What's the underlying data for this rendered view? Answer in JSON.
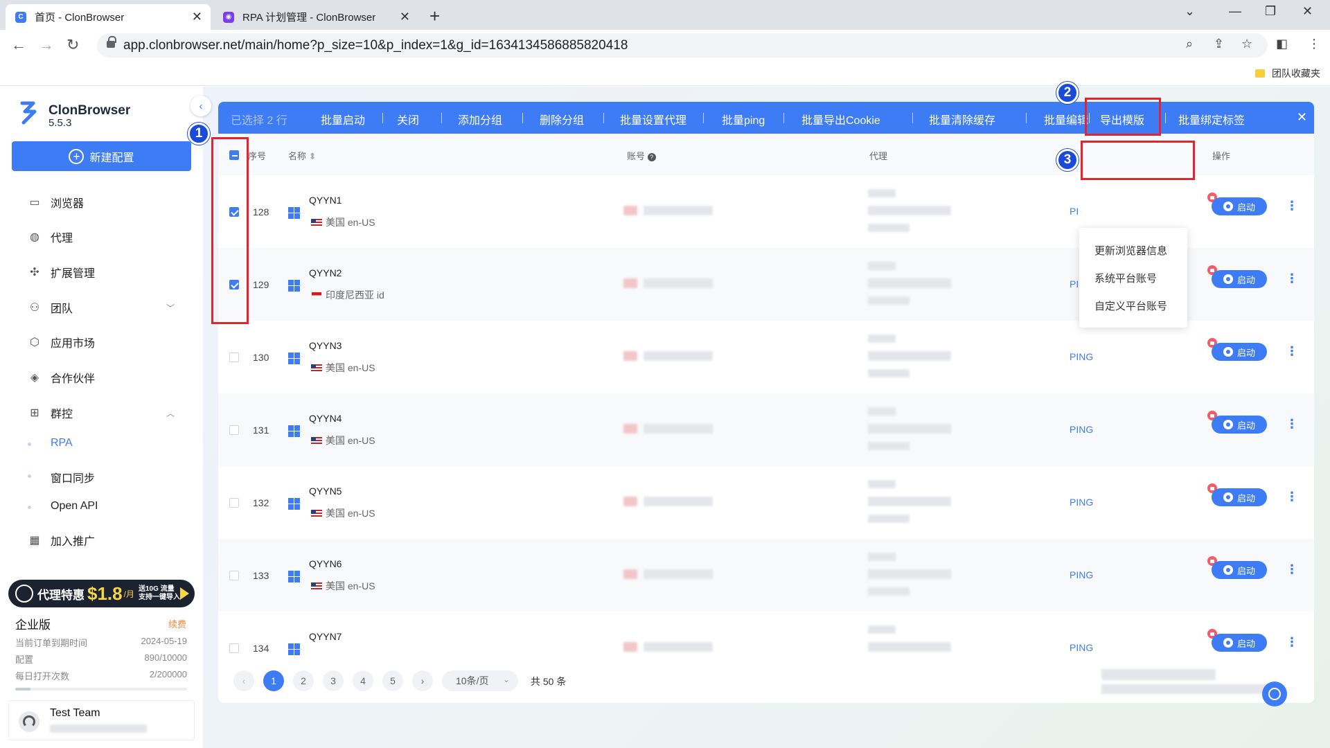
{
  "browser": {
    "tabs": [
      {
        "title": "首页 - ClonBrowser",
        "active": true
      },
      {
        "title": "RPA 计划管理 - ClonBrowser",
        "active": false
      }
    ],
    "url": "app.clonbrowser.net/main/home?p_size=10&p_index=1&g_id=1634134586885820418",
    "bookmark": "团队收藏夹"
  },
  "sidebar": {
    "brand": "ClonBrowser",
    "version": "5.5.3",
    "new_button": "新建配置",
    "menu": [
      {
        "label": "浏览器",
        "icon": "browser-icon"
      },
      {
        "label": "代理",
        "icon": "globe-icon"
      },
      {
        "label": "扩展管理",
        "icon": "puzzle-icon"
      },
      {
        "label": "团队",
        "icon": "team-icon"
      },
      {
        "label": "应用市场",
        "icon": "cube-icon"
      },
      {
        "label": "合作伙伴",
        "icon": "handshake-icon"
      },
      {
        "label": "群控",
        "icon": "group-control-icon"
      },
      {
        "label": "加入推广",
        "icon": "promo-icon"
      }
    ],
    "submenu": [
      "RPA",
      "窗口同步",
      "Open API"
    ],
    "promo": {
      "prefix": "代理特惠",
      "price": "$1.8",
      "unit": "/月",
      "line1": "送10G 流量",
      "line2": "支持一键导入"
    },
    "plan": {
      "title": "企业版",
      "renew": "续费",
      "rows": [
        {
          "label": "当前订单到期时间",
          "value": "2024-05-19"
        },
        {
          "label": "配置",
          "value": "890/10000"
        },
        {
          "label": "每日打开次数",
          "value": "2/200000"
        }
      ],
      "usage_fraction": 0.089
    },
    "user": {
      "team": "Test Team"
    }
  },
  "action_bar": {
    "selected": "已选择 2 行",
    "actions": [
      "批量启动",
      "关闭",
      "添加分组",
      "删除分组",
      "批量设置代理",
      "批量ping",
      "批量导出Cookie",
      "批量清除缓存",
      "批量编辑",
      "导出模版",
      "批量绑定标签"
    ]
  },
  "table": {
    "headers": {
      "index": "序号",
      "name": "名称",
      "account": "账号",
      "proxy": "代理",
      "action": "操作"
    },
    "rows": [
      {
        "num": "128",
        "name": "QYYN1",
        "flag": "us",
        "region": "美国 en-US",
        "ping": "PI",
        "checked": true
      },
      {
        "num": "129",
        "name": "QYYN2",
        "flag": "id",
        "region": "印度尼西亚 id",
        "ping": "PING",
        "checked": true
      },
      {
        "num": "130",
        "name": "QYYN3",
        "flag": "us",
        "region": "美国 en-US",
        "ping": "PING",
        "checked": false
      },
      {
        "num": "131",
        "name": "QYYN4",
        "flag": "us",
        "region": "美国 en-US",
        "ping": "PING",
        "checked": false
      },
      {
        "num": "132",
        "name": "QYYN5",
        "flag": "us",
        "region": "美国 en-US",
        "ping": "PING",
        "checked": false
      },
      {
        "num": "133",
        "name": "QYYN6",
        "flag": "us",
        "region": "美国 en-US",
        "ping": "PING",
        "checked": false
      },
      {
        "num": "134",
        "name": "QYYN7",
        "flag": "us",
        "region": "",
        "ping": "PING",
        "checked": false
      }
    ],
    "start_label": "启动"
  },
  "dropdown": [
    "更新浏览器信息",
    "系统平台账号",
    "自定义平台账号"
  ],
  "badges": [
    "1",
    "2",
    "3"
  ],
  "pagination": {
    "pages": [
      "1",
      "2",
      "3",
      "4",
      "5"
    ],
    "page_size": "10条/页",
    "total": "共 50 条"
  },
  "colors": {
    "accent": "#3d7cf5",
    "highlight": "#e8222d",
    "badge": "#1a4ad9"
  }
}
